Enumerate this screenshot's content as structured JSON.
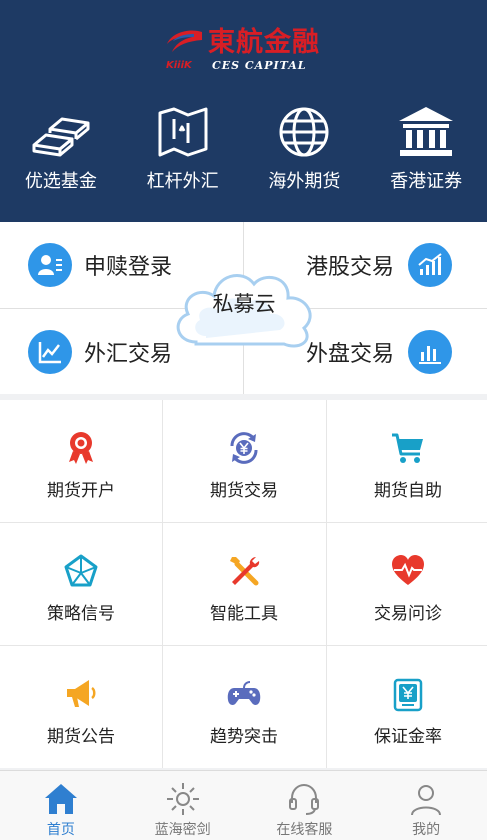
{
  "brand": {
    "name_cn": "東航金融",
    "name_en": "CES CAPITAL",
    "mark": "KiiiK"
  },
  "top_nav": [
    {
      "label": "优选基金",
      "icon": "gold-bars-icon"
    },
    {
      "label": "杠杆外汇",
      "icon": "map-icon"
    },
    {
      "label": "海外期货",
      "icon": "globe-icon"
    },
    {
      "label": "香港证券",
      "icon": "bank-icon"
    }
  ],
  "trade": {
    "center_label": "私募云",
    "items": [
      {
        "label": "申赎登录",
        "icon": "user-card-icon"
      },
      {
        "label": "港股交易",
        "icon": "chart-up-icon"
      },
      {
        "label": "外汇交易",
        "icon": "line-chart-icon"
      },
      {
        "label": "外盘交易",
        "icon": "bar-chart-icon"
      }
    ]
  },
  "services": [
    {
      "label": "期货开户",
      "icon": "award-ribbon-icon"
    },
    {
      "label": "期货交易",
      "icon": "yen-exchange-icon"
    },
    {
      "label": "期货自助",
      "icon": "shopping-cart-icon"
    },
    {
      "label": "策略信号",
      "icon": "pentagon-icon"
    },
    {
      "label": "智能工具",
      "icon": "tools-icon"
    },
    {
      "label": "交易问诊",
      "icon": "heart-pulse-icon"
    },
    {
      "label": "期货公告",
      "icon": "megaphone-icon"
    },
    {
      "label": "趋势突击",
      "icon": "gamepad-icon"
    },
    {
      "label": "保证金率",
      "icon": "yen-card-icon"
    }
  ],
  "tabbar": [
    {
      "label": "首页",
      "icon": "home-icon",
      "active": true
    },
    {
      "label": "蓝海密剑",
      "icon": "sun-icon",
      "active": false
    },
    {
      "label": "在线客服",
      "icon": "headset-icon",
      "active": false
    },
    {
      "label": "我的",
      "icon": "person-icon",
      "active": false
    }
  ],
  "colors": {
    "header_bg": "#1e3a64",
    "accent_blue": "#2f96e8",
    "brand_red": "#d81e25",
    "service_red": "#e8392c",
    "service_orange": "#f5a623",
    "service_teal": "#18a0c8"
  }
}
